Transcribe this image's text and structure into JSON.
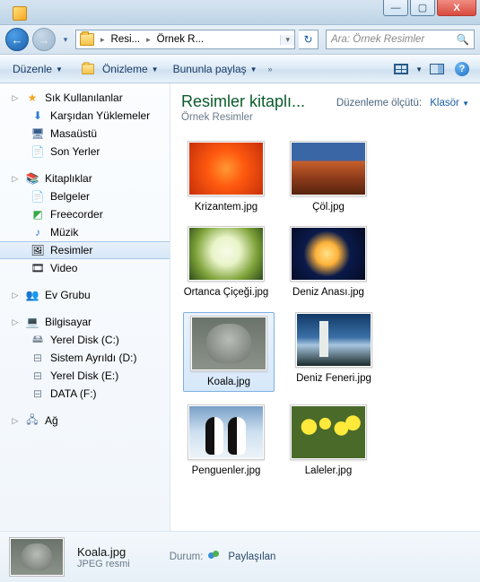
{
  "titlebar": {
    "min": "—",
    "max": "▢",
    "close": "X"
  },
  "nav": {
    "back": "←",
    "fwd": "→",
    "dd": "▾",
    "crumb1": "Resi...",
    "crumb2": "Örnek R...",
    "refresh": "↻",
    "search_placeholder": "Ara: Örnek Resimler",
    "mag": "🔍"
  },
  "toolbar": {
    "organize": "Düzenle",
    "preview": "Önizleme",
    "share": "Bununla paylaş",
    "dd": "▼"
  },
  "sidebar": {
    "fav": "Sık Kullanılanlar",
    "fav_items": [
      "Karşıdan Yüklemeler",
      "Masaüstü",
      "Son Yerler"
    ],
    "libs": "Kitaplıklar",
    "lib_items": [
      "Belgeler",
      "Freecorder",
      "Müzik",
      "Resimler",
      "Video"
    ],
    "homegroup": "Ev Grubu",
    "computer": "Bilgisayar",
    "drives": [
      "Yerel Disk (C:)",
      "Sistem Ayrıldı (D:)",
      "Yerel Disk (E:)",
      "DATA (F:)"
    ],
    "network": "Ağ"
  },
  "content": {
    "title": "Resimler kitaplı...",
    "subtitle": "Örnek Resimler",
    "sort_label": "Düzenleme ölçütü:",
    "sort_value": "Klasör",
    "items": [
      "Krizantem.jpg",
      "Çöl.jpg",
      "Ortanca Çiçeği.jpg",
      "Deniz Anası.jpg",
      "Koala.jpg",
      "Deniz Feneri.jpg",
      "Penguenler.jpg",
      "Laleler.jpg"
    ],
    "selected": "Koala.jpg"
  },
  "details": {
    "name": "Koala.jpg",
    "type": "JPEG resmi",
    "status_label": "Durum:",
    "status_value": "Paylaşılan"
  }
}
